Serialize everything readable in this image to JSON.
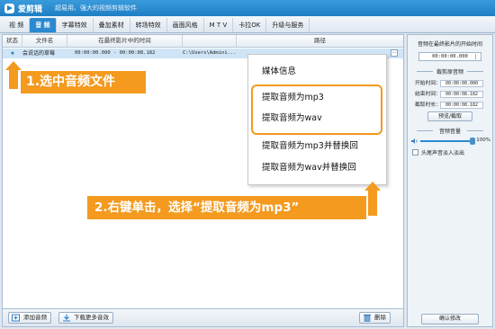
{
  "titlebar": {
    "app_name": "爱剪辑",
    "slogan": "超易用、强大的视频剪辑软件"
  },
  "tabs": [
    {
      "label": "视 频",
      "active": false
    },
    {
      "label": "音 频",
      "active": true
    },
    {
      "label": "字幕特效",
      "active": false
    },
    {
      "label": "叠加素材",
      "active": false
    },
    {
      "label": "转场特效",
      "active": false
    },
    {
      "label": "画面风格",
      "active": false
    },
    {
      "label": "M T V",
      "active": false
    },
    {
      "label": "卡拉OK",
      "active": false
    },
    {
      "label": "升级与服务",
      "active": false
    }
  ],
  "list": {
    "columns": [
      "状态",
      "文件名",
      "在最终影片中的时间",
      "",
      "路径"
    ],
    "rows": [
      {
        "status": "★",
        "name": "会说话的草莓",
        "time": "00:00:00.000 - 00:00:08.182",
        "path": "C:\\Users\\Admini...",
        "more": "···"
      }
    ]
  },
  "context_menu": {
    "items": [
      "媒体信息",
      "提取音频为mp3",
      "提取音频为wav",
      "提取音频为mp3并替换回",
      "提取音频为wav并替换回"
    ]
  },
  "callouts": {
    "step1": "1.选中音频文件",
    "step2": "2.右键单击，选择“提取音频为mp3”"
  },
  "bottom": {
    "add_audio": "添加音频",
    "download_audio": "下载更多音效",
    "delete": "删除"
  },
  "right_panel": {
    "title": "音频在最终影片的开始时间",
    "start_time_value": "00:00:00.000",
    "section_trim": "裁剪原音频",
    "start_label": "开始时间：",
    "start_value": "00:00:00.000",
    "end_label": "结束时间：",
    "end_value": "00:00:08.182",
    "duration_label": "截取时长：",
    "duration_value": "00:00:08.182",
    "preview_button": "预览/截取",
    "section_volume": "音频音量",
    "volume_fraction": 1.0,
    "volume_text": "100%",
    "fade_label": "头尾声音淡入淡出",
    "confirm_button": "确认修改"
  },
  "colors": {
    "accent": "#2b89d1",
    "callout": "#f39a1f",
    "selected_row": "#cfe5f7"
  }
}
